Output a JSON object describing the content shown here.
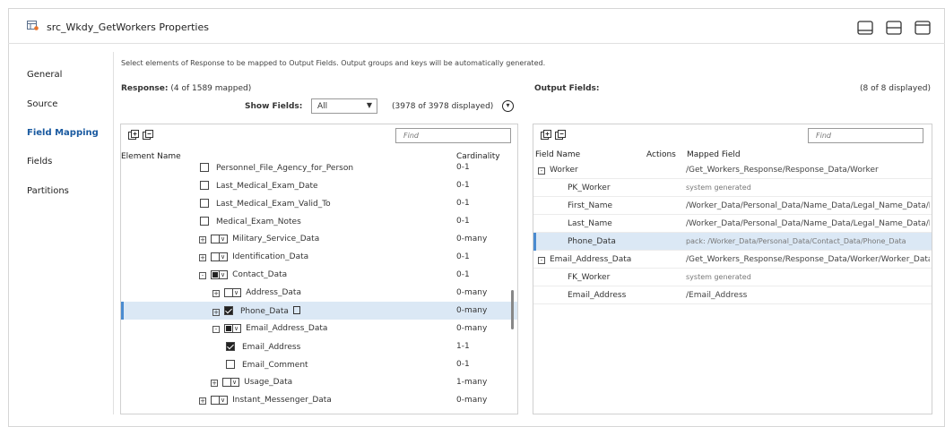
{
  "window": {
    "title": "src_Wkdy_GetWorkers Properties",
    "icons": [
      "panel-bottom-icon",
      "panel-split-icon",
      "panel-top-icon"
    ]
  },
  "nav": {
    "items": [
      {
        "label": "General",
        "active": false
      },
      {
        "label": "Source",
        "active": false
      },
      {
        "label": "Field Mapping",
        "active": true
      },
      {
        "label": "Fields",
        "active": false
      },
      {
        "label": "Partitions",
        "active": false
      }
    ]
  },
  "instructions": "Select elements of Response to be mapped to Output Fields. Output groups and keys will be automatically generated.",
  "response": {
    "label": "Response:",
    "mapped": "(4 of 1589 mapped)",
    "show_fields_label": "Show Fields:",
    "show_fields_value": "All",
    "displayed": "(3978 of 3978 displayed)",
    "find_placeholder": "Find",
    "col_element_name": "Element Name",
    "col_cardinality": "Cardinality"
  },
  "tree_rows": [
    {
      "indent": 0,
      "expander": "",
      "check": "none",
      "label": "Personnel_File_Agency_for_Person",
      "cardinality": "0-1"
    },
    {
      "indent": 0,
      "expander": "",
      "check": "none",
      "label": "Last_Medical_Exam_Date",
      "cardinality": "0-1"
    },
    {
      "indent": 0,
      "expander": "",
      "check": "none",
      "label": "Last_Medical_Exam_Valid_To",
      "cardinality": "0-1"
    },
    {
      "indent": 0,
      "expander": "",
      "check": "none",
      "label": "Medical_Exam_Notes",
      "cardinality": "0-1"
    },
    {
      "indent": 1,
      "expander": "+",
      "check": "dd",
      "label": "Military_Service_Data",
      "cardinality": "0-many"
    },
    {
      "indent": 1,
      "expander": "+",
      "check": "dd",
      "label": "Identification_Data",
      "cardinality": "0-1"
    },
    {
      "indent": 1,
      "expander": "-",
      "check": "dd-partial",
      "label": "Contact_Data",
      "cardinality": "0-1"
    },
    {
      "indent": 2,
      "expander": "+",
      "check": "dd",
      "label": "Address_Data",
      "cardinality": "0-many"
    },
    {
      "indent": 2,
      "expander": "+",
      "check": "checked",
      "label": "Phone_Data",
      "cardinality": "0-many",
      "selected": true,
      "copy": true
    },
    {
      "indent": 2,
      "expander": "-",
      "check": "dd-partial",
      "label": "Email_Address_Data",
      "cardinality": "0-many"
    },
    {
      "indent": 3,
      "expander": "",
      "check": "checked",
      "label": "Email_Address",
      "cardinality": "1-1"
    },
    {
      "indent": 3,
      "expander": "",
      "check": "none",
      "label": "Email_Comment",
      "cardinality": "0-1"
    },
    {
      "indent": 3,
      "expander": "+",
      "check": "dd",
      "label": "Usage_Data",
      "cardinality": "1-many",
      "nudge": true
    },
    {
      "indent": 1,
      "expander": "+",
      "check": "dd",
      "label": "Instant_Messenger_Data",
      "cardinality": "0-many"
    }
  ],
  "output": {
    "label": "Output Fields:",
    "count": "(8 of 8 displayed)",
    "find_placeholder": "Find",
    "col_field_name": "Field Name",
    "col_actions": "Actions",
    "col_mapped_field": "Mapped Field"
  },
  "output_rows": [
    {
      "group": true,
      "expander": "-",
      "name": "Worker",
      "mapped": "/Get_Workers_Response/Response_Data/Worker",
      "gray": false
    },
    {
      "group": false,
      "name": "PK_Worker",
      "mapped": "system generated",
      "gray": true
    },
    {
      "group": false,
      "name": "First_Name",
      "mapped": "/Worker_Data/Personal_Data/Name_Data/Legal_Name_Data/Name_Detail_Data/First_Name",
      "gray": false
    },
    {
      "group": false,
      "name": "Last_Name",
      "mapped": "/Worker_Data/Personal_Data/Name_Data/Legal_Name_Data/Name_Detail_Data/Last_Name",
      "gray": false
    },
    {
      "group": false,
      "name": "Phone_Data",
      "mapped": "pack: /Worker_Data/Personal_Data/Contact_Data/Phone_Data",
      "gray": true,
      "selected": true
    },
    {
      "group": true,
      "expander": "-",
      "name": "Email_Address_Data",
      "mapped": "/Get_Workers_Response/Response_Data/Worker/Worker_Data/Personal_Data/Contact_Data/Email_Address_Data",
      "gray": false
    },
    {
      "group": false,
      "name": "FK_Worker",
      "mapped": "system generated",
      "gray": true
    },
    {
      "group": false,
      "name": "Email_Address",
      "mapped": "/Email_Address",
      "gray": false
    }
  ]
}
